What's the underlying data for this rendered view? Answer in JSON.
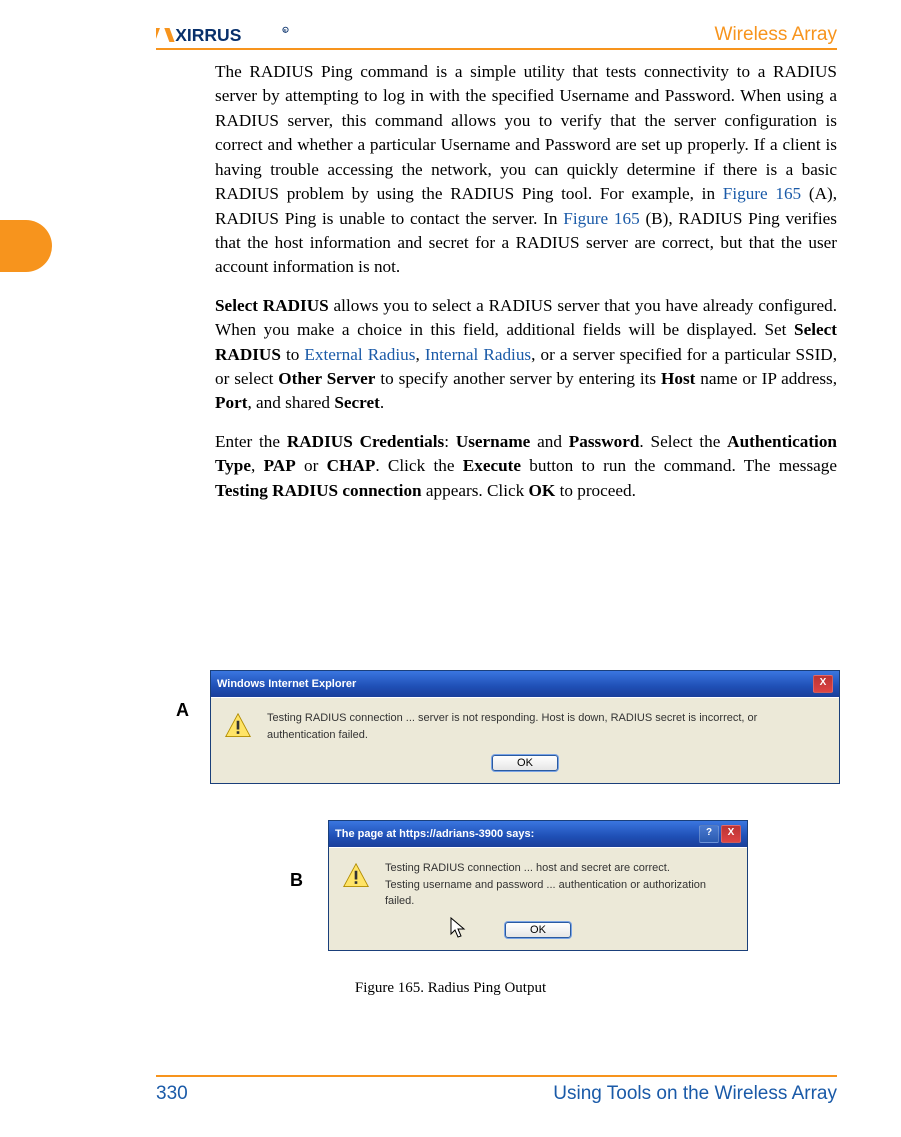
{
  "header": {
    "brand": "XIRRUS",
    "right": "Wireless Array"
  },
  "body": {
    "p1_prefix": "The RADIUS Ping command is a simple utility that tests connectivity to a RADIUS server by attempting to log in with the specified Username and Password. When using a RADIUS server, this command allows you to verify that the server configuration is correct and whether a particular Username and Password are set up properly. If a client is having trouble accessing the network, you can quickly determine if there is a basic RADIUS problem by using the RADIUS Ping tool. For example, in ",
    "fig_link_a": "Figure 165",
    "p1_mid": " (A), RADIUS Ping is unable to contact the server. In ",
    "fig_link_b": "Figure 165",
    "p1_suffix": " (B), RADIUS Ping verifies that the host information and secret for a RADIUS server are correct, but that the user account information is not.",
    "p2_b1": "Select RADIUS",
    "p2_seg1": " allows you to select a RADIUS server that you have already configured. When you make a choice in this field, additional fields will be displayed. Set ",
    "p2_b2": "Select RADIUS",
    "p2_seg2": " to ",
    "p2_link1": "External Radius",
    "p2_seg3": ", ",
    "p2_link2": "Internal Radius",
    "p2_seg4": ", or a server specified for a particular SSID, or select ",
    "p2_b3": "Other Server",
    "p2_seg5": " to specify another server by entering its ",
    "p2_b4": "Host",
    "p2_seg6": " name or IP address, ",
    "p2_b5": "Port",
    "p2_seg7": ", and shared ",
    "p2_b6": "Secret",
    "p2_seg8": ".",
    "p3_seg1": "Enter the ",
    "p3_b1": "RADIUS Credentials",
    "p3_seg2": ": ",
    "p3_b2": "Username",
    "p3_seg3": " and ",
    "p3_b3": "Password",
    "p3_seg4": ". Select the ",
    "p3_b4": "Authentication Type",
    "p3_seg5": ", ",
    "p3_b5": "PAP",
    "p3_seg6": " or ",
    "p3_b6": "CHAP",
    "p3_seg7": ". Click the ",
    "p3_b7": "Execute",
    "p3_seg8": " button to run the command. The message ",
    "p3_b8": "Testing RADIUS connection",
    "p3_seg9": " appears. Click ",
    "p3_b9": "OK",
    "p3_seg10": " to proceed."
  },
  "dialogA": {
    "label": "A",
    "title": "Windows Internet Explorer",
    "message": "Testing RADIUS connection ... server is not responding. Host is down, RADIUS secret is incorrect, or authentication failed.",
    "ok": "OK",
    "close": "X"
  },
  "dialogB": {
    "label": "B",
    "title": "The page at https://adrians-3900 says:",
    "line1": "Testing RADIUS connection ... host and secret are correct.",
    "line2": "Testing username and password ... authentication or authorization failed.",
    "ok": "OK",
    "close": "X"
  },
  "figure_caption": "Figure 165. Radius Ping Output",
  "footer": {
    "page": "330",
    "section": "Using Tools on the Wireless Array"
  }
}
